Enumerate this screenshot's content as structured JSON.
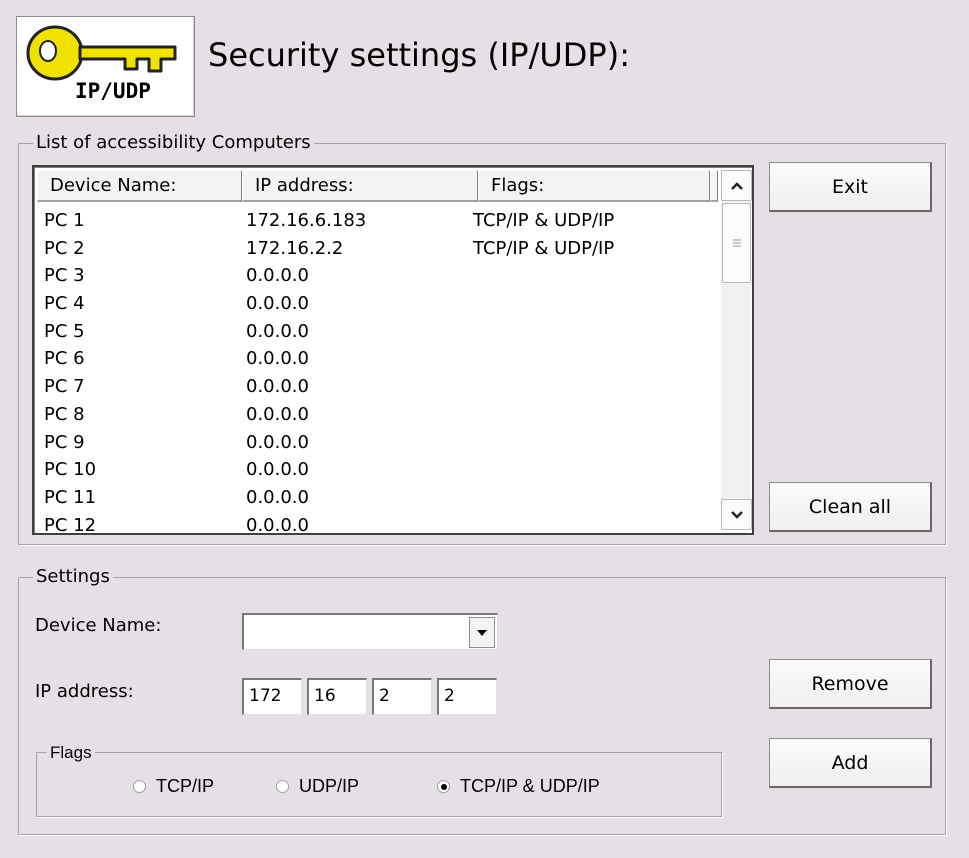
{
  "header": {
    "logo_text": "IP/UDP",
    "title": "Security settings (IP/UDP):"
  },
  "list_group": {
    "legend": "List of accessibility Computers",
    "columns": [
      "Device Name:",
      "IP address:",
      "Flags:"
    ],
    "rows": [
      [
        "PC 1",
        "172.16.6.183",
        "TCP/IP & UDP/IP"
      ],
      [
        "PC 2",
        "172.16.2.2",
        "TCP/IP & UDP/IP"
      ],
      [
        "PC 3",
        "0.0.0.0",
        ""
      ],
      [
        "PC 4",
        "0.0.0.0",
        ""
      ],
      [
        "PC 5",
        "0.0.0.0",
        ""
      ],
      [
        "PC 6",
        "0.0.0.0",
        ""
      ],
      [
        "PC 7",
        "0.0.0.0",
        ""
      ],
      [
        "PC 8",
        "0.0.0.0",
        ""
      ],
      [
        "PC 9",
        "0.0.0.0",
        ""
      ],
      [
        "PC 10",
        "0.0.0.0",
        ""
      ],
      [
        "PC 11",
        "0.0.0.0",
        ""
      ],
      [
        "PC 12",
        "0.0.0.0",
        ""
      ]
    ],
    "buttons": {
      "exit": "Exit",
      "clean_all": "Clean all"
    }
  },
  "settings": {
    "legend": "Settings",
    "device_name_label": "Device Name:",
    "device_name_value": "",
    "ip_label": "IP address:",
    "ip": [
      "172",
      "16",
      "2",
      "2"
    ],
    "flags_legend": "Flags",
    "flag_options": [
      "TCP/IP",
      "UDP/IP",
      "TCP/IP & UDP/IP"
    ],
    "flag_selected": "TCP/IP & UDP/IP",
    "buttons": {
      "remove": "Remove",
      "add": "Add"
    }
  },
  "colors": {
    "background": "#e7dfe6",
    "logo_key": "#f0e200"
  },
  "icons": {
    "logo": "key-icon",
    "scroll_up": "chevron-up-icon",
    "scroll_down": "chevron-down-icon",
    "dropdown": "triangle-down-icon"
  }
}
